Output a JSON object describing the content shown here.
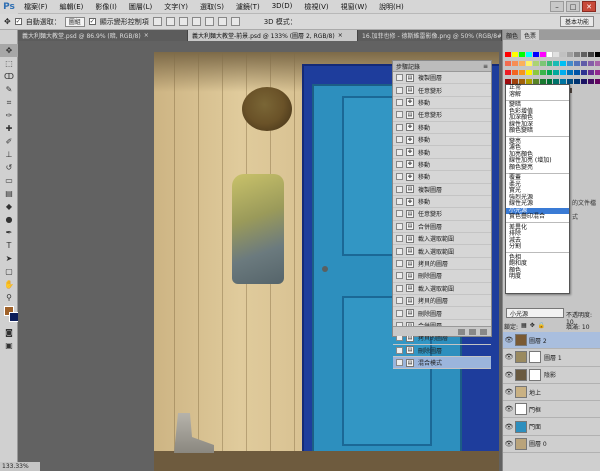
{
  "menu": {
    "logo": "Ps",
    "items": [
      "檔案(F)",
      "編輯(E)",
      "影像(I)",
      "圖層(L)",
      "文字(Y)",
      "選取(S)",
      "濾鏡(T)",
      "3D(D)",
      "檢視(V)",
      "視窗(W)",
      "說明(H)"
    ]
  },
  "options": {
    "auto_select_label": "自動選取：",
    "auto_select_value": "圖組",
    "show_transform_label": "顯示變形控制項",
    "mode_3d_label": "3D 模式：",
    "workspace_label": "基本功能"
  },
  "tabs": [
    {
      "label": "義大利麵大教堂.psd @ 86.9% (暗, RGB/8)",
      "active": false
    },
    {
      "label": "義大利麵大教堂-前景.psd @ 133% (圖層 2, RGB/8)",
      "active": true
    },
    {
      "label": "16.加菲也修 - 德斯維雷影像.png @ 50% (RGB/8#)",
      "active": false
    }
  ],
  "history": {
    "title": "步驟記錄",
    "rows": [
      {
        "label": "複製圖層",
        "icon": "layer-icon"
      },
      {
        "label": "任意變形",
        "icon": "layer-icon"
      },
      {
        "label": "移動",
        "icon": "move-icon"
      },
      {
        "label": "任意變形",
        "icon": "layer-icon"
      },
      {
        "label": "移動",
        "icon": "move-icon"
      },
      {
        "label": "移動",
        "icon": "move-icon"
      },
      {
        "label": "移動",
        "icon": "move-icon"
      },
      {
        "label": "移動",
        "icon": "move-icon"
      },
      {
        "label": "移動",
        "icon": "move-icon"
      },
      {
        "label": "複製圖層",
        "icon": "layer-icon"
      },
      {
        "label": "移動",
        "icon": "move-icon"
      },
      {
        "label": "任意變形",
        "icon": "layer-icon"
      },
      {
        "label": "合併圖層",
        "icon": "layer-icon"
      },
      {
        "label": "載入選取範圍",
        "icon": "layer-icon"
      },
      {
        "label": "載入選取範圍",
        "icon": "layer-icon"
      },
      {
        "label": "拷貝的圖層",
        "icon": "layer-icon"
      },
      {
        "label": "刪除圖層",
        "icon": "layer-icon"
      },
      {
        "label": "載入選取範圍",
        "icon": "layer-icon"
      },
      {
        "label": "拷貝的圖層",
        "icon": "layer-icon"
      },
      {
        "label": "刪除圖層",
        "icon": "layer-icon"
      },
      {
        "label": "合併圖層",
        "icon": "layer-icon"
      },
      {
        "label": "拷貝的圖層",
        "icon": "layer-icon"
      },
      {
        "label": "刪除圖層",
        "icon": "layer-icon"
      },
      {
        "label": "混合模式",
        "icon": "layer-icon",
        "active": true
      }
    ]
  },
  "right_panel": {
    "tabs": [
      "顏色",
      "色票"
    ],
    "swatch_colors": [
      "#ff0000",
      "#ffff00",
      "#00ff00",
      "#00ffff",
      "#0000ff",
      "#ff00ff",
      "#ffffff",
      "#e0e0e0",
      "#c0c0c0",
      "#a0a0a0",
      "#808080",
      "#606060",
      "#404040",
      "#000000",
      "#f26c4f",
      "#f68e55",
      "#fbaf5c",
      "#fff467",
      "#acd372",
      "#7cc576",
      "#3bb878",
      "#1abbb4",
      "#00bff3",
      "#438ccb",
      "#5574b9",
      "#605ca8",
      "#855fa8",
      "#a763a8",
      "#ed1c24",
      "#f26522",
      "#f7941d",
      "#fff200",
      "#8dc73f",
      "#39b54a",
      "#00a651",
      "#00a99d",
      "#00aeef",
      "#0072bc",
      "#0054a6",
      "#2e3192",
      "#662d91",
      "#92278f",
      "#9e0b0f",
      "#a0410d",
      "#a3620a",
      "#aba000",
      "#598527",
      "#1a7b30",
      "#007236",
      "#00746b",
      "#0076a3",
      "#004b80",
      "#003471",
      "#1b1464",
      "#440e62",
      "#630460",
      "#c69c6d",
      "#a67c52",
      "#8c6239",
      "#754c24",
      "#603913",
      "#3c2415",
      "#c7b299",
      "#998675",
      "#736357",
      "#534741",
      "#37302a",
      "#f5989d",
      "#fdc689",
      "#fff799"
    ],
    "blend_modes": [
      [
        "正常",
        "溶解"
      ],
      [
        "變暗",
        "色彩增值",
        "加深顏色",
        "線性加深",
        "顏色變暗"
      ],
      [
        "變亮",
        "濾色",
        "加亮顏色",
        "線性加亮 (增加)",
        "顏色變亮"
      ],
      [
        "覆蓋",
        "柔光",
        "實光",
        "強烈光源",
        "線性光源",
        "小光源",
        "實色疊印混合"
      ],
      [
        "差異化",
        "排除",
        "減去",
        "分割"
      ],
      [
        "色相",
        "飽和度",
        "顏色",
        "明度"
      ]
    ],
    "selected_blend": "小光源",
    "blend_select_value": "小光源",
    "opacity_label": "不透明度: 10",
    "lock_label": "鎖定:",
    "fill_label": "填滿: 10",
    "side_text": [
      "的文件檔",
      "",
      "式"
    ]
  },
  "layers": [
    {
      "name": "圖層 2",
      "active": true,
      "thumb": "#7a5a34",
      "mask": false
    },
    {
      "name": "圖層 1",
      "active": false,
      "thumb": "#9a8a60",
      "mask": true
    },
    {
      "name": "陰影",
      "active": false,
      "thumb": "#6a5a40",
      "mask": true
    },
    {
      "name": "地上",
      "active": false,
      "thumb": "#c9b183",
      "mask": false
    },
    {
      "name": "門框",
      "active": false,
      "thumb": "#ffffff",
      "mask": false
    },
    {
      "name": "門面",
      "active": false,
      "thumb": "#2d8fbe",
      "mask": false
    },
    {
      "name": "圖層 0",
      "active": false,
      "thumb": "#b9a37a",
      "mask": false
    }
  ],
  "status": {
    "zoom": "133.33%"
  }
}
